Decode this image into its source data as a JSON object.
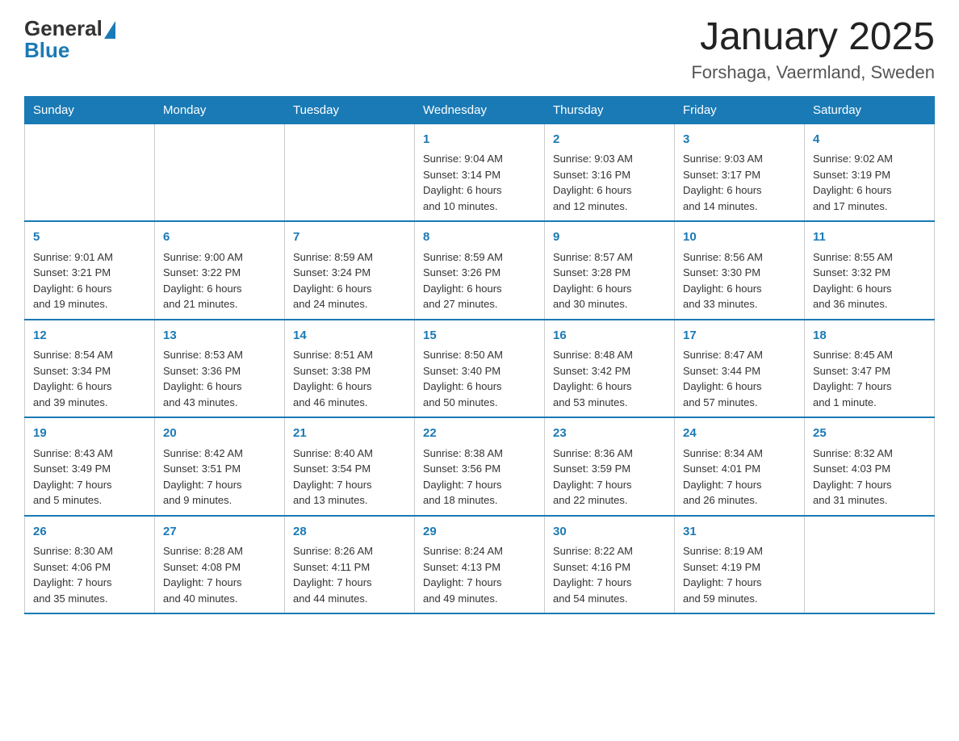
{
  "logo": {
    "general": "General",
    "blue": "Blue"
  },
  "title": "January 2025",
  "subtitle": "Forshaga, Vaermland, Sweden",
  "weekdays": [
    "Sunday",
    "Monday",
    "Tuesday",
    "Wednesday",
    "Thursday",
    "Friday",
    "Saturday"
  ],
  "weeks": [
    [
      {
        "day": "",
        "info": ""
      },
      {
        "day": "",
        "info": ""
      },
      {
        "day": "",
        "info": ""
      },
      {
        "day": "1",
        "info": "Sunrise: 9:04 AM\nSunset: 3:14 PM\nDaylight: 6 hours\nand 10 minutes."
      },
      {
        "day": "2",
        "info": "Sunrise: 9:03 AM\nSunset: 3:16 PM\nDaylight: 6 hours\nand 12 minutes."
      },
      {
        "day": "3",
        "info": "Sunrise: 9:03 AM\nSunset: 3:17 PM\nDaylight: 6 hours\nand 14 minutes."
      },
      {
        "day": "4",
        "info": "Sunrise: 9:02 AM\nSunset: 3:19 PM\nDaylight: 6 hours\nand 17 minutes."
      }
    ],
    [
      {
        "day": "5",
        "info": "Sunrise: 9:01 AM\nSunset: 3:21 PM\nDaylight: 6 hours\nand 19 minutes."
      },
      {
        "day": "6",
        "info": "Sunrise: 9:00 AM\nSunset: 3:22 PM\nDaylight: 6 hours\nand 21 minutes."
      },
      {
        "day": "7",
        "info": "Sunrise: 8:59 AM\nSunset: 3:24 PM\nDaylight: 6 hours\nand 24 minutes."
      },
      {
        "day": "8",
        "info": "Sunrise: 8:59 AM\nSunset: 3:26 PM\nDaylight: 6 hours\nand 27 minutes."
      },
      {
        "day": "9",
        "info": "Sunrise: 8:57 AM\nSunset: 3:28 PM\nDaylight: 6 hours\nand 30 minutes."
      },
      {
        "day": "10",
        "info": "Sunrise: 8:56 AM\nSunset: 3:30 PM\nDaylight: 6 hours\nand 33 minutes."
      },
      {
        "day": "11",
        "info": "Sunrise: 8:55 AM\nSunset: 3:32 PM\nDaylight: 6 hours\nand 36 minutes."
      }
    ],
    [
      {
        "day": "12",
        "info": "Sunrise: 8:54 AM\nSunset: 3:34 PM\nDaylight: 6 hours\nand 39 minutes."
      },
      {
        "day": "13",
        "info": "Sunrise: 8:53 AM\nSunset: 3:36 PM\nDaylight: 6 hours\nand 43 minutes."
      },
      {
        "day": "14",
        "info": "Sunrise: 8:51 AM\nSunset: 3:38 PM\nDaylight: 6 hours\nand 46 minutes."
      },
      {
        "day": "15",
        "info": "Sunrise: 8:50 AM\nSunset: 3:40 PM\nDaylight: 6 hours\nand 50 minutes."
      },
      {
        "day": "16",
        "info": "Sunrise: 8:48 AM\nSunset: 3:42 PM\nDaylight: 6 hours\nand 53 minutes."
      },
      {
        "day": "17",
        "info": "Sunrise: 8:47 AM\nSunset: 3:44 PM\nDaylight: 6 hours\nand 57 minutes."
      },
      {
        "day": "18",
        "info": "Sunrise: 8:45 AM\nSunset: 3:47 PM\nDaylight: 7 hours\nand 1 minute."
      }
    ],
    [
      {
        "day": "19",
        "info": "Sunrise: 8:43 AM\nSunset: 3:49 PM\nDaylight: 7 hours\nand 5 minutes."
      },
      {
        "day": "20",
        "info": "Sunrise: 8:42 AM\nSunset: 3:51 PM\nDaylight: 7 hours\nand 9 minutes."
      },
      {
        "day": "21",
        "info": "Sunrise: 8:40 AM\nSunset: 3:54 PM\nDaylight: 7 hours\nand 13 minutes."
      },
      {
        "day": "22",
        "info": "Sunrise: 8:38 AM\nSunset: 3:56 PM\nDaylight: 7 hours\nand 18 minutes."
      },
      {
        "day": "23",
        "info": "Sunrise: 8:36 AM\nSunset: 3:59 PM\nDaylight: 7 hours\nand 22 minutes."
      },
      {
        "day": "24",
        "info": "Sunrise: 8:34 AM\nSunset: 4:01 PM\nDaylight: 7 hours\nand 26 minutes."
      },
      {
        "day": "25",
        "info": "Sunrise: 8:32 AM\nSunset: 4:03 PM\nDaylight: 7 hours\nand 31 minutes."
      }
    ],
    [
      {
        "day": "26",
        "info": "Sunrise: 8:30 AM\nSunset: 4:06 PM\nDaylight: 7 hours\nand 35 minutes."
      },
      {
        "day": "27",
        "info": "Sunrise: 8:28 AM\nSunset: 4:08 PM\nDaylight: 7 hours\nand 40 minutes."
      },
      {
        "day": "28",
        "info": "Sunrise: 8:26 AM\nSunset: 4:11 PM\nDaylight: 7 hours\nand 44 minutes."
      },
      {
        "day": "29",
        "info": "Sunrise: 8:24 AM\nSunset: 4:13 PM\nDaylight: 7 hours\nand 49 minutes."
      },
      {
        "day": "30",
        "info": "Sunrise: 8:22 AM\nSunset: 4:16 PM\nDaylight: 7 hours\nand 54 minutes."
      },
      {
        "day": "31",
        "info": "Sunrise: 8:19 AM\nSunset: 4:19 PM\nDaylight: 7 hours\nand 59 minutes."
      },
      {
        "day": "",
        "info": ""
      }
    ]
  ]
}
